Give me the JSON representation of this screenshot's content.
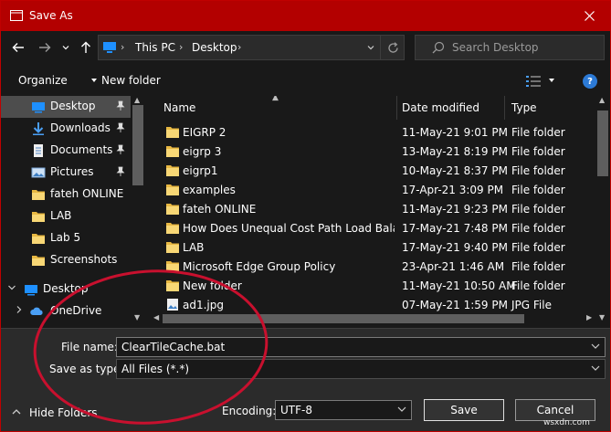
{
  "window": {
    "title": "Save As",
    "accent_color": "#b30000"
  },
  "address": {
    "crumbs": [
      "This PC",
      "Desktop"
    ]
  },
  "search": {
    "placeholder": "Search Desktop"
  },
  "toolbar": {
    "organize_label": "Organize",
    "new_folder_label": "New folder"
  },
  "nav_pane": {
    "items": [
      {
        "label": "Desktop",
        "icon": "desktop-blue-icon",
        "pinned": true,
        "selected": true
      },
      {
        "label": "Downloads",
        "icon": "download-arrow-icon",
        "pinned": true
      },
      {
        "label": "Documents",
        "icon": "document-icon",
        "pinned": true
      },
      {
        "label": "Pictures",
        "icon": "pictures-icon",
        "pinned": true
      },
      {
        "label": "fateh ONLINE",
        "icon": "folder-icon"
      },
      {
        "label": "LAB",
        "icon": "folder-icon"
      },
      {
        "label": "Lab 5",
        "icon": "folder-icon"
      },
      {
        "label": "Screenshots",
        "icon": "folder-icon"
      },
      {
        "label": "Desktop",
        "icon": "desktop-blue-icon",
        "root": true,
        "expanded": true
      },
      {
        "label": "OneDrive",
        "icon": "cloud-icon",
        "child": true
      }
    ]
  },
  "file_list": {
    "columns": [
      "Name",
      "Date modified",
      "Type"
    ],
    "rows": [
      {
        "name": "EIGRP 2",
        "date": "11-May-21 9:01 PM",
        "type": "File folder",
        "icon": "folder-icon"
      },
      {
        "name": "eigrp 3",
        "date": "13-May-21 8:19 PM",
        "type": "File folder",
        "icon": "folder-icon"
      },
      {
        "name": "eigrp1",
        "date": "10-May-21 8:37 PM",
        "type": "File folder",
        "icon": "folder-icon"
      },
      {
        "name": "examples",
        "date": "17-Apr-21 3:09 PM",
        "type": "File folder",
        "icon": "folder-icon"
      },
      {
        "name": "fateh ONLINE",
        "date": "11-May-21 9:23 PM",
        "type": "File folder",
        "icon": "folder-icon"
      },
      {
        "name": "How Does Unequal Cost Path Load Balan...",
        "date": "17-May-21 7:48 PM",
        "type": "File folder",
        "icon": "folder-icon"
      },
      {
        "name": "LAB",
        "date": "17-May-21 9:40 PM",
        "type": "File folder",
        "icon": "folder-icon"
      },
      {
        "name": "Microsoft Edge Group Policy",
        "date": "23-Apr-21 1:46 AM",
        "type": "File folder",
        "icon": "folder-icon"
      },
      {
        "name": "New folder",
        "date": "11-May-21 10:50 AM",
        "type": "File folder",
        "icon": "folder-icon"
      },
      {
        "name": "ad1.jpg",
        "date": "07-May-21 1:59 PM",
        "type": "JPG File",
        "icon": "image-file-icon"
      }
    ]
  },
  "form": {
    "file_name_label": "File name:",
    "file_name_value": "ClearTileCache.bat",
    "save_type_label": "Save as type:",
    "save_type_value": "All Files  (*.*)",
    "encoding_label": "Encoding:",
    "encoding_value": "UTF-8",
    "save_label": "Save",
    "cancel_label": "Cancel",
    "hide_folders_label": "Hide Folders"
  },
  "annotation": {
    "color": "#c8102e"
  },
  "watermark": "wsxdn.com"
}
